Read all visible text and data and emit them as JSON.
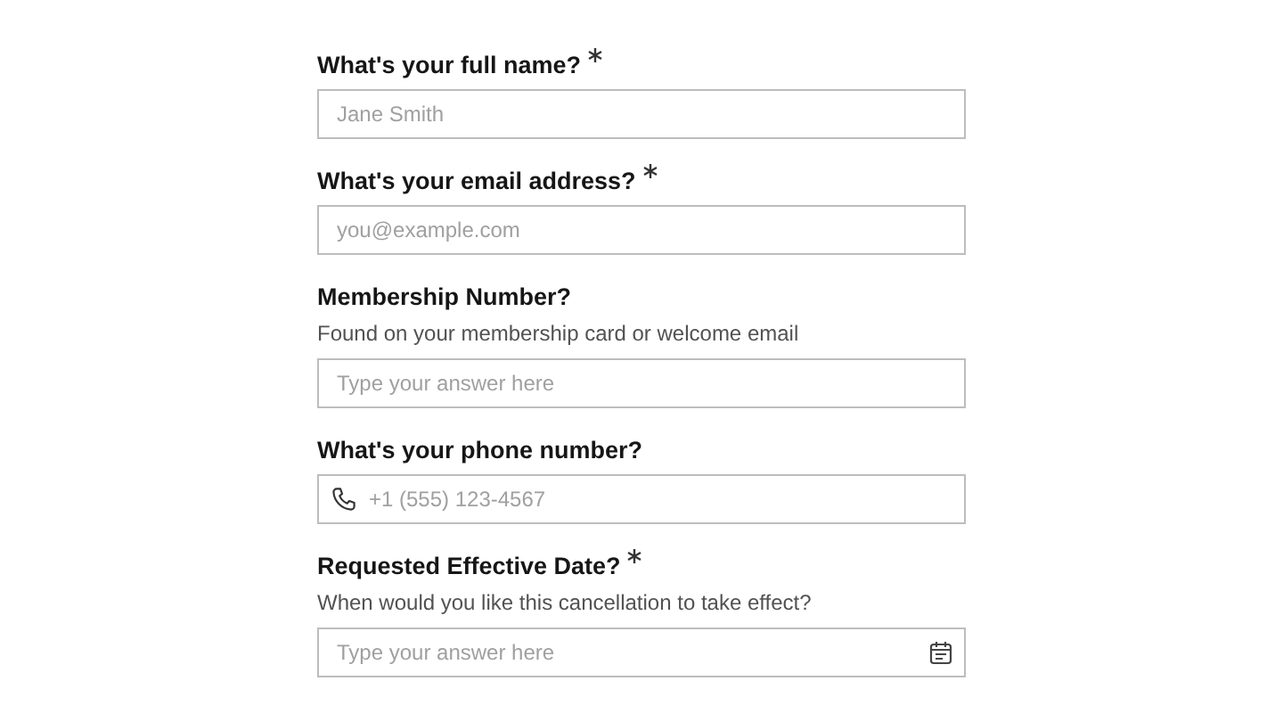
{
  "questions": [
    {
      "label": "What's your full name?",
      "required": true,
      "kind": "text",
      "placeholder": "Jane Smith"
    },
    {
      "label": "What's your email address?",
      "required": true,
      "kind": "text",
      "placeholder": "you@example.com"
    },
    {
      "label": "Membership Number?",
      "required": false,
      "hint": "Found on your membership card or welcome email",
      "kind": "text",
      "placeholder": "Type your answer here"
    },
    {
      "label": "What's your phone number?",
      "required": false,
      "kind": "phone",
      "placeholder": "+1 (555) 123-4567"
    },
    {
      "label": "Requested Effective Date?",
      "required": true,
      "hint": "When would you like this cancellation to take effect?",
      "kind": "date",
      "placeholder": "Type your answer here"
    }
  ]
}
